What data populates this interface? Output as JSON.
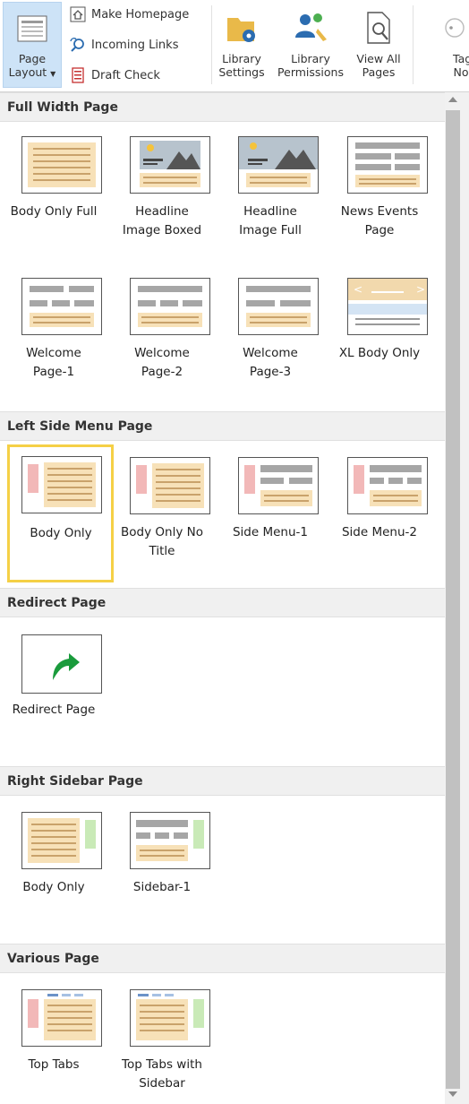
{
  "ribbon": {
    "page_layout_label_1": "Page",
    "page_layout_label_2": "Layout",
    "make_homepage": "Make Homepage",
    "incoming_links": "Incoming Links",
    "draft_check": "Draft Check",
    "library_settings_1": "Library",
    "library_settings_2": "Settings",
    "library_permissions_1": "Library",
    "library_permissions_2": "Permissions",
    "view_all_pages_1": "View All",
    "view_all_pages_2": "Pages",
    "tags_1": "Tag",
    "tags_2": "No"
  },
  "sections": {
    "full_width": "Full Width Page",
    "left_side_menu": "Left Side Menu Page",
    "redirect": "Redirect Page",
    "right_sidebar": "Right Sidebar Page",
    "various": "Various Page"
  },
  "tiles": {
    "body_only_full": [
      "Body Only Full"
    ],
    "headline_image_boxed": [
      "Headline",
      "Image Boxed"
    ],
    "headline_image_full": [
      "Headline",
      "Image Full"
    ],
    "news_events_page": [
      "News Events",
      "Page"
    ],
    "welcome_1": [
      "Welcome",
      "Page-1"
    ],
    "welcome_2": [
      "Welcome",
      "Page-2"
    ],
    "welcome_3": [
      "Welcome",
      "Page-3"
    ],
    "xl_body_only": [
      "XL Body Only"
    ],
    "left_body_only": [
      "Body Only"
    ],
    "body_only_no_title": [
      "Body Only No",
      "Title"
    ],
    "side_menu_1": [
      "Side Menu-1"
    ],
    "side_menu_2": [
      "Side Menu-2"
    ],
    "redirect_page": [
      "Redirect Page"
    ],
    "right_body_only": [
      "Body Only"
    ],
    "sidebar_1": [
      "Sidebar-1"
    ],
    "top_tabs": [
      "Top Tabs"
    ],
    "top_tabs_sidebar": [
      "Top Tabs with",
      "Sidebar"
    ]
  },
  "colors": {
    "selected_border": "#f5d046",
    "section_bg": "#f0f0f0",
    "ribbon_active": "#cde3f7",
    "redirect_arrow": "#1a9b3c"
  }
}
